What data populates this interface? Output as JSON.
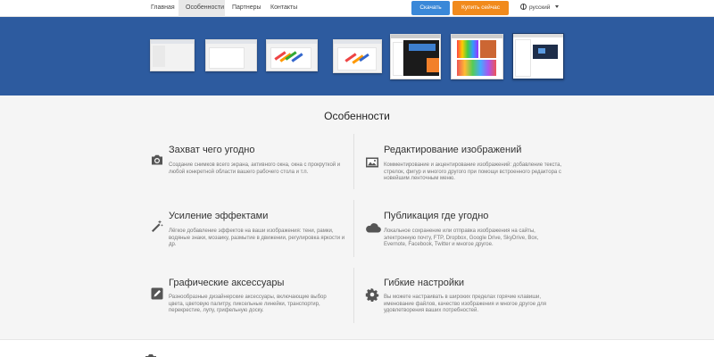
{
  "nav": {
    "links": [
      "Главная",
      "Особенности",
      "Партнеры",
      "Контакты"
    ],
    "download_button": "Скачать",
    "buy_button": "Купить сейчас",
    "language": "русский"
  },
  "banner": {
    "thumbnails": [
      "thumb-1",
      "thumb-2",
      "thumb-3",
      "thumb-4",
      "thumb-5",
      "thumb-6",
      "thumb-7"
    ]
  },
  "features": {
    "title": "Особенности",
    "items": [
      {
        "icon": "camera-icon",
        "title": "Захват чего угодно",
        "desc": "Создание снимков всего экрана, активного окна, окна с прокруткой и любой конкретной области вашего рабочего стола и т.п."
      },
      {
        "icon": "image-icon",
        "title": "Редактирование изображений",
        "desc": "Комментирование и акцентирование изображений: добавление текста, стрелок, фигур и многого другого при помощи встроенного редактора с новейшим ленточным меню."
      },
      {
        "icon": "magic-wand-icon",
        "title": "Усиление эффектами",
        "desc": "Лёгкое добавление эффектов на ваши изображения: тени, рамки, водяные знаки, мозаику, размытие в движении, регулировка яркости и др."
      },
      {
        "icon": "cloud-icon",
        "title": "Публикация где угодно",
        "desc": "Локальное сохранение или отправка изображения на сайты, электронную почту, FTP, Dropbox, Google Drive, SkyDrive, Box, Evernote, Facebook, Twitter и многое другое."
      },
      {
        "icon": "pencil-icon",
        "title": "Графические аксессуары",
        "desc": "Разнообразные дизайнерские аксессуары, включающие выбор цвета, цветовую палитру, пиксельные линейки, транспортир, перекрестие, лупу, грифельную доску."
      },
      {
        "icon": "gear-icon",
        "title": "Гибкие настройки",
        "desc": "Вы можете настраивать в широких пределах горячие клавиши, именование файлов, качество изображения и многое другое для удовлетворения ваших потребностей."
      }
    ]
  },
  "colors": {
    "banner": "#2d5b9f",
    "download": "#3a88d8",
    "buy": "#f18a1c"
  }
}
